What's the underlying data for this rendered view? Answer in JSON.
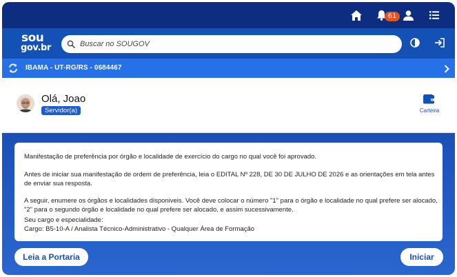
{
  "header": {
    "notifications_count": "61",
    "icons": [
      "home-icon",
      "bell-icon",
      "user-icon",
      "menu-icon"
    ]
  },
  "brand": {
    "logo_line1": "sou",
    "logo_line2": "gov.br"
  },
  "search": {
    "placeholder": "Buscar no SOUGOV"
  },
  "org_bar": {
    "text": "IBAMA - UT-RG/RS - 0684467"
  },
  "profile": {
    "greeting": "Olá, Joao",
    "role": "Servidor(a)",
    "wallet_label": "Carteira"
  },
  "message": {
    "p1": "Manifestação de preferência por órgão e localidade de exercício do cargo no qual você foi aprovado.",
    "p2": "Antes de iniciar sua manifestação de ordem de preferência, leia o EDITAL Nº 228, DE 30 DE JULHO DE  2026  e as orientações em tela antes de enviar sua resposta.",
    "p3": "A seguir, enumere os órgãos e localidades disponiveis. Você deve colocar o número \"1\" para o órgão e localidade no qual prefere ser alocado, \"2\" para o segundo órgão e localidade no qual prefere ser alocado, e assim sucessivamente.",
    "p4_label": "Seu cargo e especialidade:",
    "p4_value": "Cargo: B5-10-A / Analista Técnico-Administrativo - Qualquer Área de Formação"
  },
  "actions": {
    "read_label": "Leia a Portaria",
    "start_label": "Iniciar"
  },
  "colors": {
    "topbar": "#0c2d80",
    "searchbar": "#1351b4",
    "orgbar": "#2670e8",
    "badge": "#e8501e",
    "accent": "#1351b4"
  }
}
